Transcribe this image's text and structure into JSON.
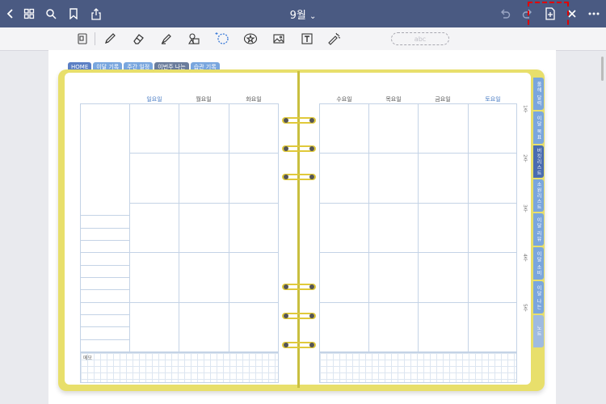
{
  "topbar": {
    "title": "9월",
    "title_caret": "⌄"
  },
  "toolbar": {
    "zoom_pill": "abc"
  },
  "planner": {
    "top_tabs": [
      {
        "label": "HOME",
        "color": "#5b7fc4"
      },
      {
        "label": "이달 기록",
        "color": "#79a6de"
      },
      {
        "label": "주간 일정",
        "color": "#79a6de"
      },
      {
        "label": "이번주 나는",
        "color": "#6b7d9c"
      },
      {
        "label": "습관 기록",
        "color": "#79a6de"
      }
    ],
    "side_tabs": [
      {
        "label": "올해 달력",
        "color": "#7aa6dd"
      },
      {
        "label": "이달 목표",
        "color": "#7aa6dd"
      },
      {
        "label": "버킷리스트",
        "color": "#4a6cb0"
      },
      {
        "label": "소원리스트",
        "color": "#7aa6dd"
      },
      {
        "label": "이달 리뷰",
        "color": "#7aa6dd"
      },
      {
        "label": "이달 소비",
        "color": "#7aa6dd"
      },
      {
        "label": "이달 나는",
        "color": "#7aa6dd"
      },
      {
        "label": "노트",
        "color": "#9fbbe0"
      }
    ],
    "left_days": [
      "일요일",
      "월요일",
      "화요일"
    ],
    "right_days": [
      "수요일",
      "목요일",
      "금요일",
      "토요일"
    ],
    "week_labels": [
      "1주",
      "2주",
      "3주",
      "4주",
      "5주"
    ],
    "memo_label": "메모"
  }
}
